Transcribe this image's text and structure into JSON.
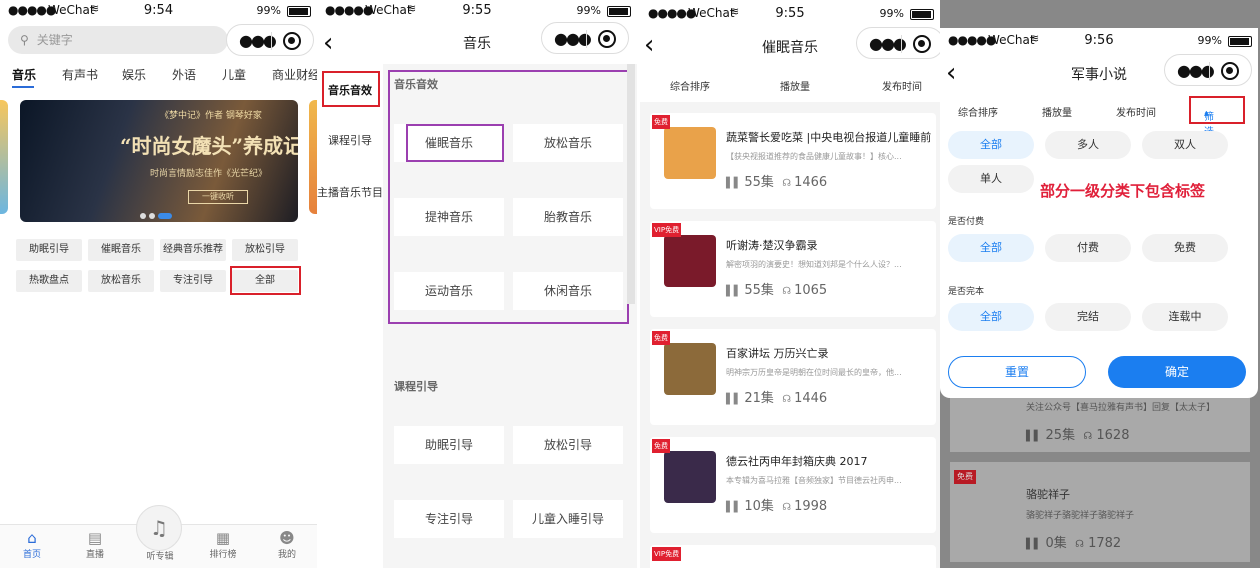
{
  "status": {
    "carrier": "WeChat",
    "battery": "99%",
    "times": [
      "9:54",
      "9:55",
      "9:55",
      "9:56"
    ]
  },
  "panel1": {
    "search_placeholder": "关键字",
    "tabs": [
      "音乐",
      "有声书",
      "娱乐",
      "外语",
      "儿童",
      "商业财经"
    ],
    "banner": {
      "small_text": "《梦中记》作者 钢琴好家",
      "headline": "“时尚女魔头”养成记",
      "subline": "时尚言情励志佳作《光芒纪》",
      "button": "一键收听"
    },
    "chips": [
      "助眠引导",
      "催眠音乐",
      "经典音乐推荐",
      "放松引导",
      "热歌盘点",
      "放松音乐",
      "专注引导",
      "全部"
    ],
    "tabbar": [
      "首页",
      "直播",
      "听专辑",
      "排行榜",
      "我的"
    ]
  },
  "panel2": {
    "title": "音乐",
    "sidebar": [
      "音乐音效",
      "课程引导",
      "主播音乐节目"
    ],
    "section1_title": "音乐音效",
    "section1_items": [
      "催眠音乐",
      "放松音乐",
      "提神音乐",
      "胎教音乐",
      "运动音乐",
      "休闲音乐"
    ],
    "section2_title": "课程引导",
    "section2_items": [
      "助眠引导",
      "放松引导",
      "专注引导",
      "儿童入睡引导"
    ]
  },
  "panel3": {
    "title": "催眠音乐",
    "sort_options": [
      "综合排序",
      "播放量",
      "发布时间"
    ],
    "cards": [
      {
        "tag": "免费",
        "title": "蔬菜警长爱吃菜 |中央电视台报道儿童睡前",
        "desc": "【获央视报道推荐的食品健康儿童故事！】核心...",
        "episodes": "55集",
        "plays": "1466",
        "cover_color": "#e9a24a"
      },
      {
        "tag": "VIP免费",
        "title": "听谢涛·楚汉争霸录",
        "desc": "解密项羽的演要史！想知道刘邦是个什么人设？...",
        "episodes": "55集",
        "plays": "1065",
        "cover_color": "#7a1a2a"
      },
      {
        "tag": "免费",
        "title": "百家讲坛 万历兴亡录",
        "desc": "明神宗万历皇帝是明朝在位时间最长的皇帝，他...",
        "episodes": "21集",
        "plays": "1446",
        "cover_color": "#8c6a3a"
      },
      {
        "tag": "免费",
        "title": "德云社丙申年封箱庆典 2017",
        "desc": "本专辑为喜马拉雅【音频独家】节目德云社丙申...",
        "episodes": "10集",
        "plays": "1998",
        "cover_color": "#3a2a4a"
      }
    ],
    "partial_tag": "VIP免费"
  },
  "panel4": {
    "title": "军事小说",
    "sort_options": [
      "综合排序",
      "播放量",
      "发布时间"
    ],
    "filter_label": "筛选",
    "chips_row1": [
      "全部",
      "多人",
      "双人"
    ],
    "chips_row2": [
      "单人"
    ],
    "annotation": "部分一级分类下包含标签",
    "group_paid": "是否付费",
    "paid_options": [
      "全部",
      "付费",
      "免费"
    ],
    "group_finished": "是否完本",
    "finished_options": [
      "全部",
      "完结",
      "连载中"
    ],
    "reset": "重置",
    "confirm": "确定",
    "bg_card1": {
      "desc": "关注公众号【喜马拉雅有声书】回复【太太子】",
      "episodes": "25集",
      "plays": "1628"
    },
    "bg_card2": {
      "tag": "免费",
      "title": "骆驼祥子",
      "desc": "骆驼祥子骆驼祥子骆驼祥子",
      "episodes": "0集",
      "plays": "1782"
    }
  },
  "colors": {
    "accent_blue": "#1b7ef0",
    "highlight_red": "#d9202a",
    "highlight_purple": "#9b3fb0"
  }
}
